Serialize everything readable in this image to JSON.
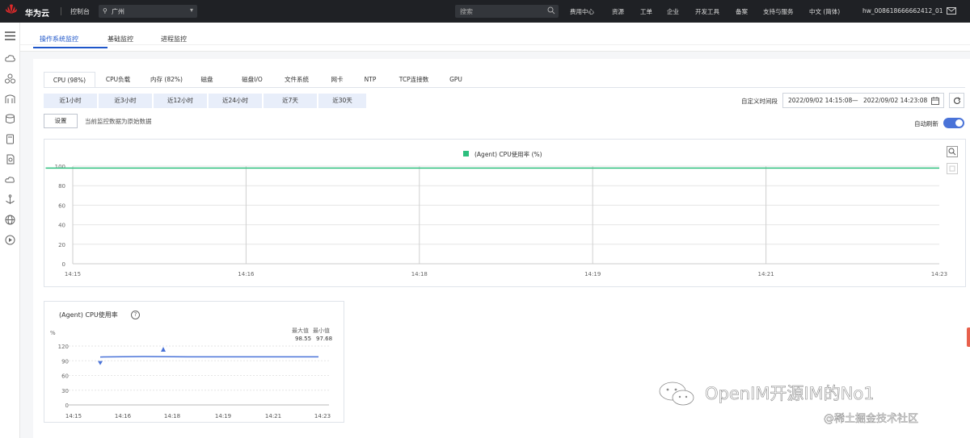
{
  "topbar": {
    "logo_sub": "HUAWEI",
    "brand": "华为云",
    "console": "控制台",
    "region": "广州",
    "search_placeholder": "搜索",
    "nav": [
      "费用中心",
      "资源",
      "工单",
      "企业",
      "开发工具",
      "备案",
      "支持与服务",
      "中文 (简体)",
      "hw_008618666662412_01"
    ]
  },
  "tabs": [
    "操作系统监控",
    "基础监控",
    "进程监控"
  ],
  "subtabs": [
    "CPU (98%)",
    "CPU负载",
    "内存 (82%)",
    "磁盘",
    "磁盘I/O",
    "文件系统",
    "网卡",
    "NTP",
    "TCP连接数",
    "GPU"
  ],
  "ranges": [
    "近1小时",
    "近3小时",
    "近12小时",
    "近24小时",
    "近7天",
    "近30天"
  ],
  "custom_range_label": "自定义时间段",
  "date_start": "2022/09/02 14:15:08",
  "date_sep": "—",
  "date_end": "2022/09/02 14:23:08",
  "settings_label": "设置",
  "raw_note": "当前监控数据为原始数据",
  "auto_refresh_label": "自动刷新",
  "colors": {
    "accent": "#1e56c9",
    "series_big": "#2dbf7e",
    "series_small": "#4a73d8"
  },
  "chart_data": [
    {
      "type": "line",
      "legend": "(Agent) CPU使用率 (%)",
      "x": [
        "14:15",
        "14:16",
        "14:18",
        "14:19",
        "14:21",
        "14:23"
      ],
      "yticks": [
        100,
        80,
        60,
        40,
        20,
        0
      ],
      "ylim": [
        0,
        100
      ],
      "series": [
        {
          "name": "(Agent) CPU使用率 (%)",
          "start": 14.75,
          "end": 23,
          "values": [
            98,
            98,
            98,
            98,
            98,
            98
          ]
        }
      ],
      "grid": true,
      "legend_position": "top-center"
    },
    {
      "type": "line",
      "title": "(Agent) CPU使用率",
      "unit": "%",
      "x": [
        "14:15",
        "14:16",
        "14:18",
        "14:19",
        "14:21",
        "14:23"
      ],
      "yticks": [
        120,
        90,
        60,
        30,
        0
      ],
      "ylim": [
        0,
        120
      ],
      "series": [
        {
          "values": [
            97.68,
            98.55,
            98,
            98,
            98,
            98
          ]
        }
      ],
      "max_label": "最大值",
      "min_label": "最小值",
      "max": "98.55",
      "min": "97.68"
    }
  ],
  "help_glyph": "?",
  "watermark": "OpenIM开源IM的No1",
  "watermark_sub": "@稀土掘金技术社区"
}
